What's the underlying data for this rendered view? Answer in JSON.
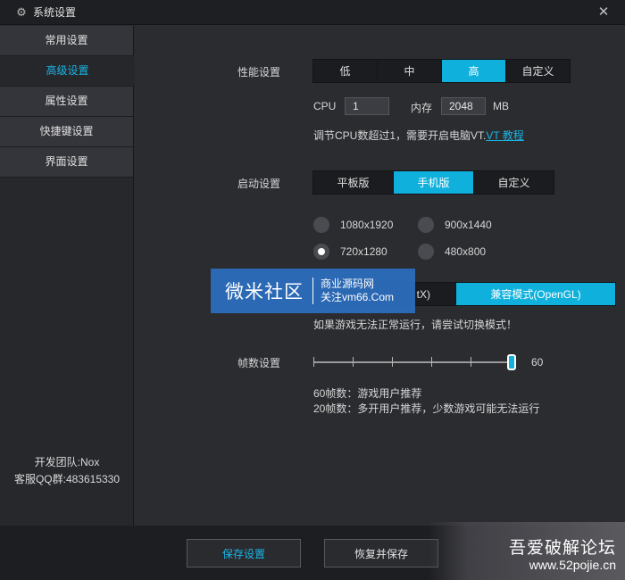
{
  "window": {
    "title": "系统设置",
    "gear_icon": "gear-icon",
    "close_icon": "close-icon"
  },
  "sidebar": {
    "items": [
      {
        "label": "常用设置",
        "active": false
      },
      {
        "label": "高级设置",
        "active": true
      },
      {
        "label": "属性设置",
        "active": false
      },
      {
        "label": "快捷键设置",
        "active": false
      },
      {
        "label": "界面设置",
        "active": false
      }
    ],
    "footer_team": "开发团队:Nox",
    "footer_qq": "客服QQ群:483615330"
  },
  "performance": {
    "label": "性能设置",
    "options": [
      "低",
      "中",
      "高",
      "自定义"
    ],
    "selected": "高",
    "cpu_label": "CPU",
    "cpu_value": "1",
    "mem_label": "内存",
    "mem_value": "2048",
    "mem_unit": "MB",
    "hint_text": "调节CPU数超过1，需要开启电脑VT.",
    "hint_link": "VT 教程"
  },
  "startup": {
    "label": "启动设置",
    "options": [
      "平板版",
      "手机版",
      "自定义"
    ],
    "selected": "手机版",
    "resolutions": [
      "1080x1920",
      "900x1440",
      "720x1280",
      "480x800"
    ],
    "selected_resolution": "720x1280"
  },
  "render": {
    "option_left": "tX)",
    "option_right": "兼容模式(OpenGL)",
    "selected": "兼容模式(OpenGL)",
    "hint": "如果游戏无法正常运行，请尝试切换模式！"
  },
  "fps": {
    "label": "帧数设置",
    "value": "60",
    "level_fraction": 1.0,
    "note1": "60帧数：游戏用户推荐",
    "note2": "20帧数：多开用户推荐，少数游戏可能无法运行"
  },
  "buttons": {
    "save": "保存设置",
    "restore": "恢复并保存"
  },
  "watermark1": {
    "big": "微米社区",
    "line1": "商业源码网",
    "line2": "关注vm66.Com"
  },
  "watermark2": {
    "line1": "吾爱破解论坛",
    "line2": "www.52pojie.cn"
  },
  "colors": {
    "accent": "#0fb1dc",
    "panel": "#2b2c30",
    "sidebar": "#34353a",
    "watermark_blue": "#2b6ebe"
  }
}
